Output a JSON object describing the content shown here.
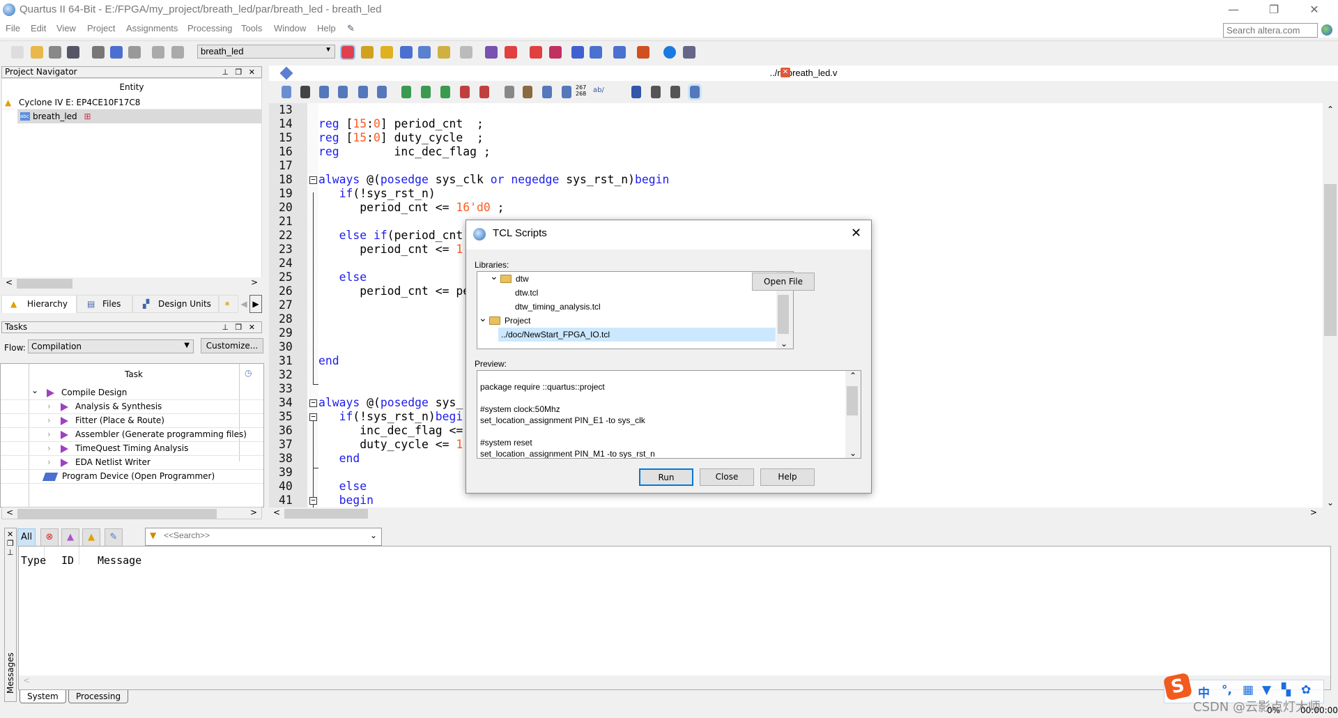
{
  "window": {
    "title": "Quartus II 64-Bit - E:/FPGA/my_project/breath_led/par/breath_led - breath_led",
    "minimize": "—",
    "restore": "❐",
    "close": "✕"
  },
  "menu": [
    "File",
    "Edit",
    "View",
    "Project",
    "Assignments",
    "Processing",
    "Tools",
    "Window",
    "Help"
  ],
  "search": {
    "placeholder": "Search altera.com"
  },
  "toolbar": {
    "entity_combo": "breath_led",
    "icons": [
      "new-file",
      "open-file",
      "save",
      "save-all",
      "cut",
      "copy",
      "paste",
      "undo",
      "redo",
      "pin-planner",
      "assignment-editor",
      "edit-settings",
      "analysis-elaboration",
      "analysis-synthesis",
      "fitter",
      "stop",
      "start-compilation",
      "timequest",
      "power-analyzer",
      "rtl-viewer",
      "technology-map-viewer",
      "programmer",
      "chip-planner",
      "netlist-navigator",
      "help",
      "whats-this"
    ]
  },
  "navigator": {
    "title": "Project Navigator",
    "column": "Entity",
    "device": "Cyclone IV E: EP4CE10F17C8",
    "top_entity": "breath_led",
    "tabs": [
      "Hierarchy",
      "Files",
      "Design Units"
    ]
  },
  "tasks": {
    "title": "Tasks",
    "flow_label": "Flow:",
    "flow_value": "Compilation",
    "customize": "Customize...",
    "column": "Task",
    "items": [
      {
        "label": "Compile Design",
        "level": 0
      },
      {
        "label": "Analysis & Synthesis",
        "level": 1
      },
      {
        "label": "Fitter (Place & Route)",
        "level": 1
      },
      {
        "label": "Assembler (Generate programming files)",
        "level": 1
      },
      {
        "label": "TimeQuest Timing Analysis",
        "level": 1
      },
      {
        "label": "EDA Netlist Writer",
        "level": 1
      },
      {
        "label": "Program Device (Open Programmer)",
        "level": -1
      }
    ]
  },
  "editor": {
    "file_tab": "../rtl/breath_led.v",
    "tb_numbers": "267\n268",
    "tb_ab": "ab/",
    "lines": [
      {
        "n": "13",
        "t": []
      },
      {
        "n": "14",
        "t": [
          [
            "reg",
            "k"
          ],
          [
            " [",
            ""
          ],
          [
            "15",
            "nm"
          ],
          [
            ":",
            ""
          ],
          [
            "0",
            "nm"
          ],
          [
            "] period_cnt  ;",
            ""
          ]
        ]
      },
      {
        "n": "15",
        "t": [
          [
            "reg",
            "k"
          ],
          [
            " [",
            ""
          ],
          [
            "15",
            "nm"
          ],
          [
            ":",
            ""
          ],
          [
            "0",
            "nm"
          ],
          [
            "] duty_cycle  ;",
            ""
          ]
        ]
      },
      {
        "n": "16",
        "t": [
          [
            "reg",
            "k"
          ],
          [
            "        inc_dec_flag ;",
            ""
          ]
        ]
      },
      {
        "n": "17",
        "t": []
      },
      {
        "n": "18",
        "t": [
          [
            "always",
            "k"
          ],
          [
            " @(",
            ""
          ],
          [
            "posedge",
            "k"
          ],
          [
            " sys_clk ",
            ""
          ],
          [
            "or",
            "k"
          ],
          [
            " ",
            ""
          ],
          [
            "negedge",
            "k"
          ],
          [
            " sys_rst_n)",
            ""
          ],
          [
            "begin",
            "k"
          ]
        ]
      },
      {
        "n": "19",
        "t": [
          [
            "   ",
            ""
          ],
          [
            "if",
            "k"
          ],
          [
            "(!sys_rst_n)",
            ""
          ]
        ]
      },
      {
        "n": "20",
        "t": [
          [
            "      period_cnt <= ",
            ""
          ],
          [
            "16'd0",
            "nm"
          ],
          [
            " ;",
            ""
          ]
        ]
      },
      {
        "n": "21",
        "t": []
      },
      {
        "n": "22",
        "t": [
          [
            "   ",
            ""
          ],
          [
            "else",
            "k"
          ],
          [
            " ",
            ""
          ],
          [
            "if",
            "k"
          ],
          [
            "(period_cnt",
            ""
          ]
        ]
      },
      {
        "n": "23",
        "t": [
          [
            "      period_cnt <= ",
            ""
          ],
          [
            "1",
            "nm"
          ]
        ]
      },
      {
        "n": "24",
        "t": []
      },
      {
        "n": "25",
        "t": [
          [
            "   ",
            ""
          ],
          [
            "else",
            "k"
          ]
        ]
      },
      {
        "n": "26",
        "t": [
          [
            "      period_cnt <= pe",
            ""
          ]
        ]
      },
      {
        "n": "27",
        "t": []
      },
      {
        "n": "28",
        "t": []
      },
      {
        "n": "29",
        "t": []
      },
      {
        "n": "30",
        "t": []
      },
      {
        "n": "31",
        "t": [
          [
            "end",
            "k"
          ]
        ]
      },
      {
        "n": "32",
        "t": []
      },
      {
        "n": "33",
        "t": []
      },
      {
        "n": "34",
        "t": [
          [
            "always",
            "k"
          ],
          [
            " @(",
            ""
          ],
          [
            "posedge",
            "k"
          ],
          [
            " sys_",
            ""
          ]
        ]
      },
      {
        "n": "35",
        "t": [
          [
            "   ",
            ""
          ],
          [
            "if",
            "k"
          ],
          [
            "(!sys_rst_n)",
            ""
          ],
          [
            "begi",
            "k"
          ]
        ]
      },
      {
        "n": "36",
        "t": [
          [
            "      inc_dec_flag <=",
            ""
          ]
        ]
      },
      {
        "n": "37",
        "t": [
          [
            "      duty_cycle <= ",
            ""
          ],
          [
            "1",
            "nm"
          ]
        ]
      },
      {
        "n": "38",
        "t": [
          [
            "   ",
            ""
          ],
          [
            "end",
            "k"
          ]
        ]
      },
      {
        "n": "39",
        "t": []
      },
      {
        "n": "40",
        "t": [
          [
            "   ",
            ""
          ],
          [
            "else",
            "k"
          ]
        ]
      },
      {
        "n": "41",
        "t": [
          [
            "   ",
            ""
          ],
          [
            "begin",
            "k"
          ]
        ]
      }
    ]
  },
  "dialog": {
    "title": "TCL Scripts",
    "libraries_label": "Libraries:",
    "tree": [
      {
        "label": "dtw",
        "type": "folder"
      },
      {
        "label": "dtw.tcl",
        "type": "file"
      },
      {
        "label": "dtw_timing_analysis.tcl",
        "type": "file"
      },
      {
        "label": "Project",
        "type": "folder"
      },
      {
        "label": "../doc/NewStart_FPGA_IO.tcl",
        "type": "file",
        "selected": true
      }
    ],
    "open_file": "Open File",
    "preview_label": "Preview:",
    "preview": [
      "package require ::quartus::project",
      "",
      "#system clock:50Mhz",
      "set_location_assignment PIN_E1 -to sys_clk",
      "",
      "#system reset",
      "set_location_assignment PIN_M1 -to sys_rst_n"
    ],
    "run": "Run",
    "close": "Close",
    "help": "Help"
  },
  "messages": {
    "side_label": "Messages",
    "filter_all": "All",
    "search_placeholder": "<<Search>>",
    "columns": [
      "Type",
      "ID",
      "Message"
    ],
    "tabs": [
      "System",
      "Processing"
    ]
  },
  "status": {
    "progress": "0%",
    "elapsed": "00:00:00"
  },
  "ime": {
    "lang": "中",
    "punct": "°,",
    "watermark": "CSDN @云影点灯大师"
  },
  "colors": {
    "keyword": "#1c1cf0",
    "number": "#ff5a1f",
    "selection": "#cce8ff"
  }
}
